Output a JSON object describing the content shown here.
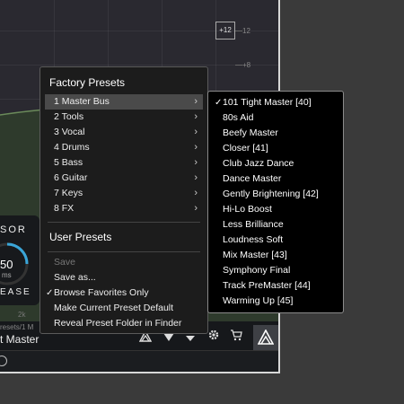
{
  "plugin": {
    "scale_box": "+12",
    "scale_labels": [
      "12",
      "+8"
    ],
    "comp_label": "SOR",
    "knob_value": "50",
    "knob_unit": "ms",
    "release_label": "EASE",
    "freq_label": "2k",
    "preset_path": "resets/1 M",
    "preset_name": "t Master",
    "accent_color": "#3aa5d8"
  },
  "main_menu": {
    "factory_header": "Factory Presets",
    "categories": [
      {
        "label": "1 Master Bus"
      },
      {
        "label": "2 Tools"
      },
      {
        "label": "3 Vocal"
      },
      {
        "label": "4 Drums"
      },
      {
        "label": "5 Bass"
      },
      {
        "label": "6 Guitar"
      },
      {
        "label": "7 Keys"
      },
      {
        "label": "8 FX"
      }
    ],
    "user_header": "User Presets",
    "actions": [
      {
        "label": "Save"
      },
      {
        "label": "Save as..."
      },
      {
        "label": "Browse Favorites Only",
        "check": "✓"
      },
      {
        "label": "Make Current Preset Default"
      },
      {
        "label": "Reveal Preset Folder in Finder"
      }
    ]
  },
  "sub_menu": {
    "items": [
      {
        "label": "101 Tight Master [40]",
        "check": "✓"
      },
      {
        "label": "80s Aid"
      },
      {
        "label": "Beefy Master"
      },
      {
        "label": "Closer [41]"
      },
      {
        "label": "Club Jazz Dance"
      },
      {
        "label": "Dance Master"
      },
      {
        "label": "Gently Brightening [42]"
      },
      {
        "label": "Hi-Lo Boost"
      },
      {
        "label": "Less Brilliance"
      },
      {
        "label": "Loudness Soft"
      },
      {
        "label": "Mix Master [43]"
      },
      {
        "label": "Symphony Final"
      },
      {
        "label": "Track PreMaster [44]"
      },
      {
        "label": "Warming Up [45]"
      }
    ]
  }
}
